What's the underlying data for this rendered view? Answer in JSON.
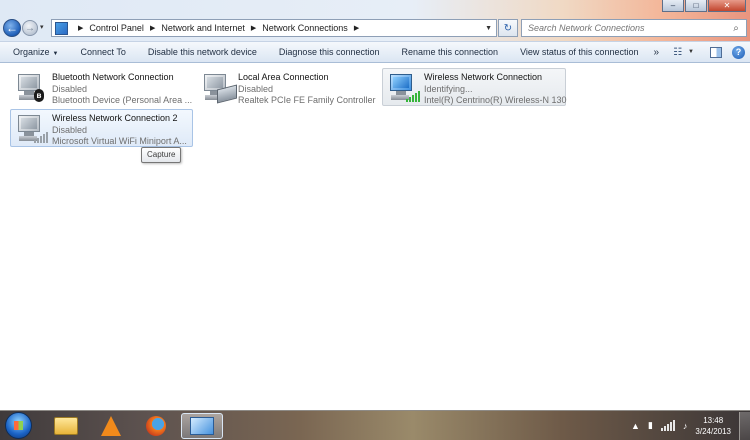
{
  "window": {
    "minimize_glyph": "–",
    "maximize_glyph": "□",
    "close_glyph": "✕"
  },
  "nav": {
    "back_glyph": "←",
    "forward_glyph": "→",
    "history_glyph": "▾"
  },
  "address": {
    "breadcrumbs": [
      "Control Panel",
      "Network and Internet",
      "Network Connections"
    ],
    "separator_glyph": "▶",
    "dropdown_glyph": "▼",
    "refresh_glyph": "↻"
  },
  "search": {
    "placeholder": "Search Network Connections",
    "icon": "search-icon",
    "icon_glyph": "⌕"
  },
  "commands": {
    "organize": "Organize",
    "connect_to": "Connect To",
    "disable": "Disable this network device",
    "diagnose": "Diagnose this connection",
    "rename": "Rename this connection",
    "view_status": "View status of this connection",
    "more": "»",
    "dropdown_glyph": "▼",
    "view_glyph": "☷"
  },
  "connections": [
    {
      "name": "Bluetooth Network Connection",
      "status": "Disabled",
      "device": "Bluetooth Device (Personal Area ...",
      "icon": "bluetooth-connection-icon",
      "badge": "bluetooth"
    },
    {
      "name": "Local Area Connection",
      "status": "Disabled",
      "device": "Realtek PCIe FE Family Controller",
      "icon": "ethernet-connection-icon",
      "badge": "nic"
    },
    {
      "name": "Wireless Network Connection",
      "status": "Identifying...",
      "device": "Intel(R) Centrino(R) Wireless-N 130",
      "icon": "wireless-connection-icon",
      "badge": "signal-green"
    },
    {
      "name": "Wireless Network Connection 2",
      "status": "Disabled",
      "device": "Microsoft Virtual WiFi Miniport A...",
      "icon": "wireless-connection-icon",
      "badge": "signal-gray"
    }
  ],
  "tooltip": {
    "text": "Capture"
  },
  "taskbar": {
    "apps": [
      "Windows Explorer",
      "VLC media player",
      "Mozilla Firefox",
      "Network Connections"
    ],
    "tray": {
      "show_hidden_glyph": "▲",
      "time": "13:48",
      "date": "3/24/2013",
      "volume_glyph": "♪"
    }
  },
  "colors": {
    "accent": "#1f5fb8",
    "selected_item_border": "#a9c4e6",
    "signal_green": "#36b53a"
  }
}
